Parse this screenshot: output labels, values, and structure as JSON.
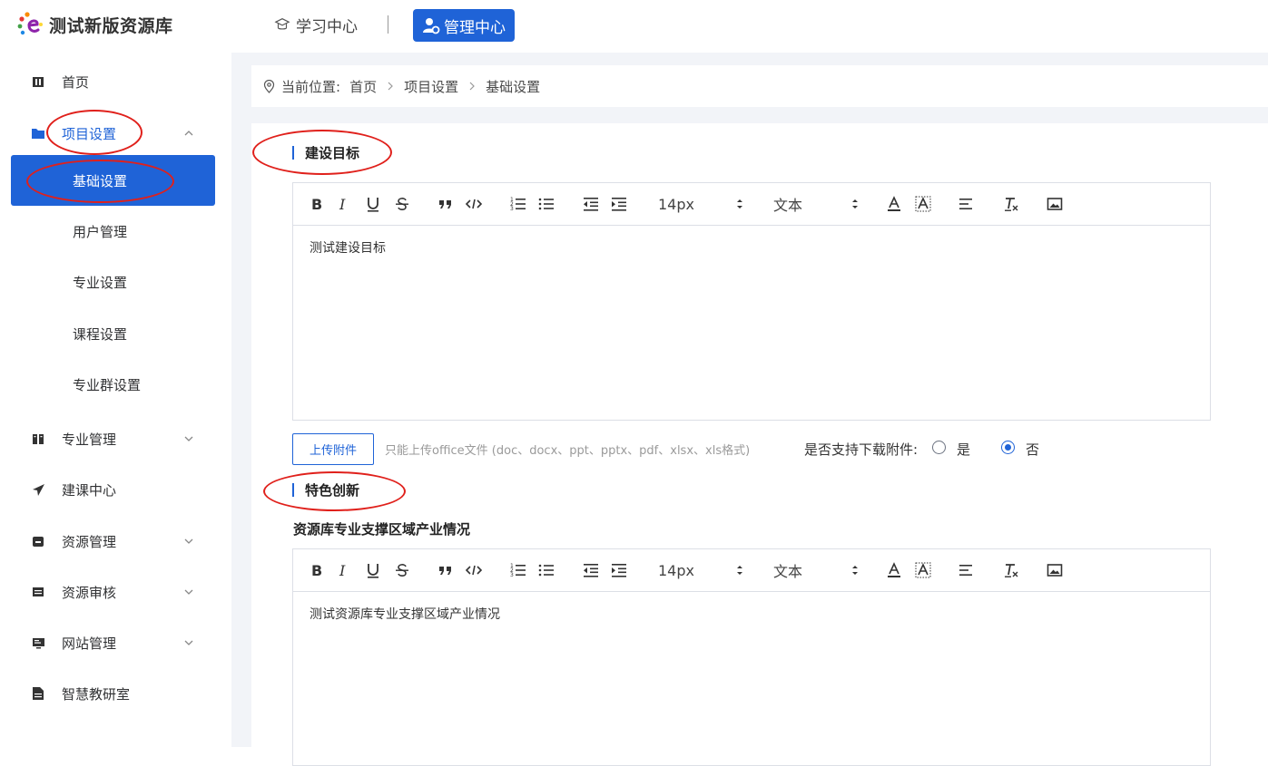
{
  "header": {
    "logo_text": "测试新版资源库",
    "nav_learn": "学习中心",
    "nav_admin": "管理中心"
  },
  "sidebar": {
    "items": [
      {
        "label": "首页",
        "icon": "building-icon"
      },
      {
        "label": "项目设置",
        "icon": "folder-icon",
        "expanded": true
      },
      {
        "label": "专业管理",
        "icon": "book-icon"
      },
      {
        "label": "建课中心",
        "icon": "paper-plane-icon"
      },
      {
        "label": "资源管理",
        "icon": "box-icon"
      },
      {
        "label": "资源审核",
        "icon": "document-list-icon"
      },
      {
        "label": "网站管理",
        "icon": "monitor-icon"
      },
      {
        "label": "智慧教研室",
        "icon": "file-icon"
      }
    ],
    "sub_items": [
      {
        "label": "基础设置",
        "active": true
      },
      {
        "label": "用户管理"
      },
      {
        "label": "专业设置"
      },
      {
        "label": "课程设置"
      },
      {
        "label": "专业群设置"
      }
    ]
  },
  "breadcrumb": {
    "prefix": "当前位置:",
    "items": [
      "首页",
      "项目设置",
      "基础设置"
    ]
  },
  "toolbar": {
    "font_size": "14px",
    "block_type": "文本"
  },
  "sections": {
    "goal_title": "建设目标",
    "goal_content": "测试建设目标",
    "feature_title": "特色创新",
    "feature_subheading": "资源库专业支撑区域产业情况",
    "feature_content": "测试资源库专业支撑区域产业情况"
  },
  "upload": {
    "button_label": "上传附件",
    "hint": "只能上传office文件 (doc、docx、ppt、pptx、pdf、xlsx、xls格式)",
    "download_label": "是否支持下载附件:",
    "option_yes": "是",
    "option_no": "否",
    "selected": "否"
  },
  "colors": {
    "primary": "#1f63d7",
    "annotation": "#e0201b",
    "page_bg": "#f2f4f8"
  }
}
